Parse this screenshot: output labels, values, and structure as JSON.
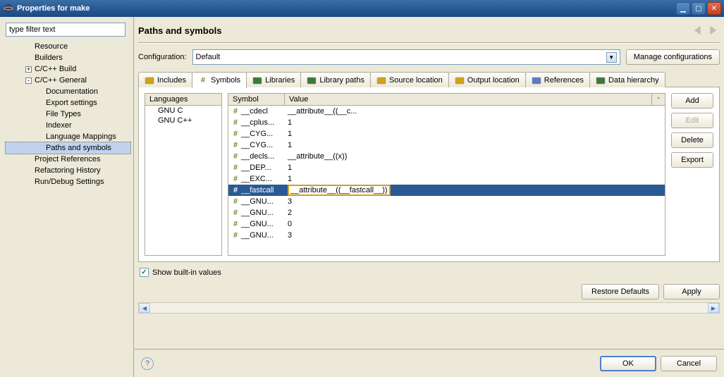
{
  "window": {
    "title": "Properties for make"
  },
  "filter_placeholder": "type filter text",
  "tree": [
    {
      "label": "Resource",
      "indent": 1,
      "expander": ""
    },
    {
      "label": "Builders",
      "indent": 1,
      "expander": ""
    },
    {
      "label": "C/C++ Build",
      "indent": 1,
      "expander": "+"
    },
    {
      "label": "C/C++ General",
      "indent": 1,
      "expander": "-"
    },
    {
      "label": "Documentation",
      "indent": 2,
      "expander": ""
    },
    {
      "label": "Export settings",
      "indent": 2,
      "expander": ""
    },
    {
      "label": "File Types",
      "indent": 2,
      "expander": ""
    },
    {
      "label": "Indexer",
      "indent": 2,
      "expander": ""
    },
    {
      "label": "Language Mappings",
      "indent": 2,
      "expander": ""
    },
    {
      "label": "Paths and symbols",
      "indent": 2,
      "expander": "",
      "selected": true
    },
    {
      "label": "Project References",
      "indent": 1,
      "expander": ""
    },
    {
      "label": "Refactoring History",
      "indent": 1,
      "expander": ""
    },
    {
      "label": "Run/Debug Settings",
      "indent": 1,
      "expander": ""
    }
  ],
  "page_header": "Paths and symbols",
  "config": {
    "label": "Configuration:",
    "value": "Default",
    "manage_btn": "Manage configurations"
  },
  "tabs": [
    {
      "label": "Includes",
      "iconColor": "#d4a017"
    },
    {
      "label": "Symbols",
      "iconColor": "#6a8a2a",
      "active": true
    },
    {
      "label": "Libraries",
      "iconColor": "#3a7a3a"
    },
    {
      "label": "Library paths",
      "iconColor": "#3a7a3a"
    },
    {
      "label": "Source location",
      "iconColor": "#d4a017"
    },
    {
      "label": "Output location",
      "iconColor": "#d4a017"
    },
    {
      "label": "References",
      "iconColor": "#5a7ac5"
    },
    {
      "label": "Data hierarchy",
      "iconColor": "#3a7a3a"
    }
  ],
  "languages_header": "Languages",
  "languages": [
    "GNU C",
    "GNU C++"
  ],
  "table": {
    "col_symbol": "Symbol",
    "col_value": "Value",
    "rows": [
      {
        "symbol": "__cdecl",
        "value": "__attribute__((__c..."
      },
      {
        "symbol": "__cplus...",
        "value": "1"
      },
      {
        "symbol": "__CYG...",
        "value": "1"
      },
      {
        "symbol": "__CYG...",
        "value": "1"
      },
      {
        "symbol": "__decls...",
        "value": "__attribute__((x))"
      },
      {
        "symbol": "__DEP...",
        "value": "1"
      },
      {
        "symbol": "__EXC...",
        "value": "1"
      },
      {
        "symbol": "__fastcall",
        "value": "__attribute__((__fastcall__))",
        "selected": true,
        "editing": true
      },
      {
        "symbol": "__GNU...",
        "value": "3"
      },
      {
        "symbol": "__GNU...",
        "value": "2"
      },
      {
        "symbol": "__GNU...",
        "value": "0"
      },
      {
        "symbol": "__GNU...",
        "value": "3"
      }
    ]
  },
  "actions": {
    "add": "Add",
    "edit": "Edit",
    "delete": "Delete",
    "export": "Export"
  },
  "show_builtin": "Show built-in values",
  "restore": "Restore Defaults",
  "apply": "Apply",
  "ok": "OK",
  "cancel": "Cancel"
}
